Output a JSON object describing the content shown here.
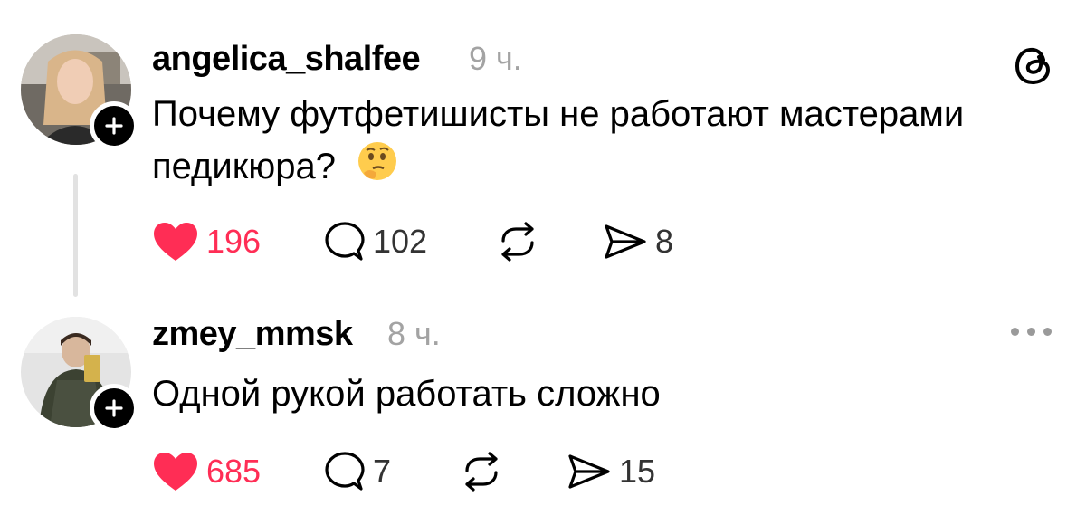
{
  "posts": [
    {
      "username": "angelica_shalfee",
      "time": "9 ч.",
      "text": "Почему футфетишисты не работают мастерами педикюра?",
      "likes": "196",
      "comments": "102",
      "shares": "8",
      "emoji": "thinking-face-icon"
    },
    {
      "username": "zmey_mmsk",
      "time": "8 ч.",
      "text": "Одной рукой работать сложно",
      "likes": "685",
      "comments": "7",
      "shares": "15"
    }
  ],
  "colors": {
    "like": "#ff2d55",
    "muted": "#a3a3a3",
    "thread_line": "#e2e2e2"
  },
  "icons": [
    "threads-logo-icon",
    "heart-icon",
    "comment-icon",
    "repost-icon",
    "share-icon",
    "plus-icon",
    "more-icon"
  ]
}
